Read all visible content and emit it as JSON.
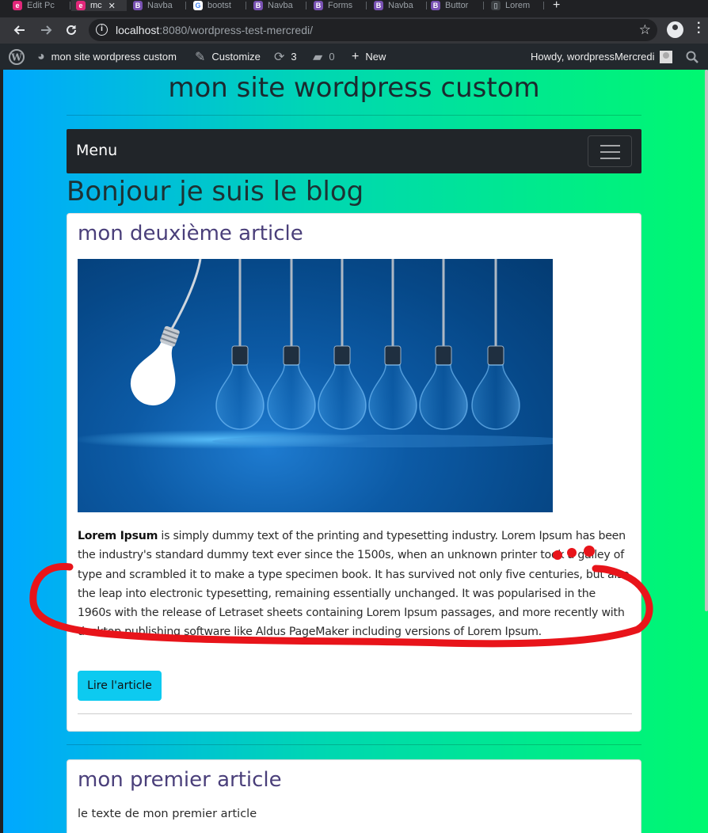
{
  "browser": {
    "tabs": [
      {
        "label": "Edit Pc",
        "icon": "elementor-icon",
        "color": "#e2277a"
      },
      {
        "label": "mc",
        "icon": "elementor-icon",
        "color": "#e2277a",
        "active": true,
        "close": "✕"
      },
      {
        "label": "Navba",
        "icon": "bootstrap-icon",
        "color": "#7952b3"
      },
      {
        "label": "bootst",
        "icon": "google-icon",
        "color": "#ffffff"
      },
      {
        "label": "Navba",
        "icon": "bootstrap-icon",
        "color": "#7952b3"
      },
      {
        "label": "Forms",
        "icon": "bootstrap-icon",
        "color": "#7952b3"
      },
      {
        "label": "Navba",
        "icon": "bootstrap-icon",
        "color": "#7952b3"
      },
      {
        "label": "Buttor",
        "icon": "bootstrap-icon",
        "color": "#7952b3"
      },
      {
        "label": "Lorem",
        "icon": "page-icon",
        "color": "#5f6368"
      }
    ],
    "new_tab": "+",
    "url_host": "localhost",
    "url_rest": ":8080/wordpress-test-mercredi/"
  },
  "adminbar": {
    "site_name": "mon site wordpress custom",
    "customize": "Customize",
    "updates": "3",
    "comments": "0",
    "new": "New",
    "howdy": "Howdy, wordpressMercredi"
  },
  "site": {
    "title": "mon site wordpress custom",
    "menu": "Menu",
    "blog_title": "Bonjour je suis le blog"
  },
  "posts": [
    {
      "title": "mon deuxième article",
      "lead_bold": "Lorem Ipsum",
      "body": "is simply dummy text of the printing and typesetting industry. Lorem Ipsum has been the industry's standard dummy text ever since the 1500s, when an unknown printer took a galley of type and scrambled it to make a type specimen book. It has survived not only five centuries, but also the leap into electronic typesetting, remaining essentially unchanged. It was popularised in the 1960s with the release of Letraset sheets containing Lorem Ipsum passages, and more recently with desktop publishing software like Aldus PageMaker including versions of Lorem Ipsum.",
      "button": "Lire l'article"
    },
    {
      "title": "mon premier article",
      "body": "le texte de mon premier article"
    }
  ],
  "colors": {
    "gradient_left": "#00a8ff",
    "gradient_right": "#00f870",
    "button_info": "#0dcaf0",
    "post_title": "#4a3f7a",
    "annotation_red": "#e8141a"
  }
}
